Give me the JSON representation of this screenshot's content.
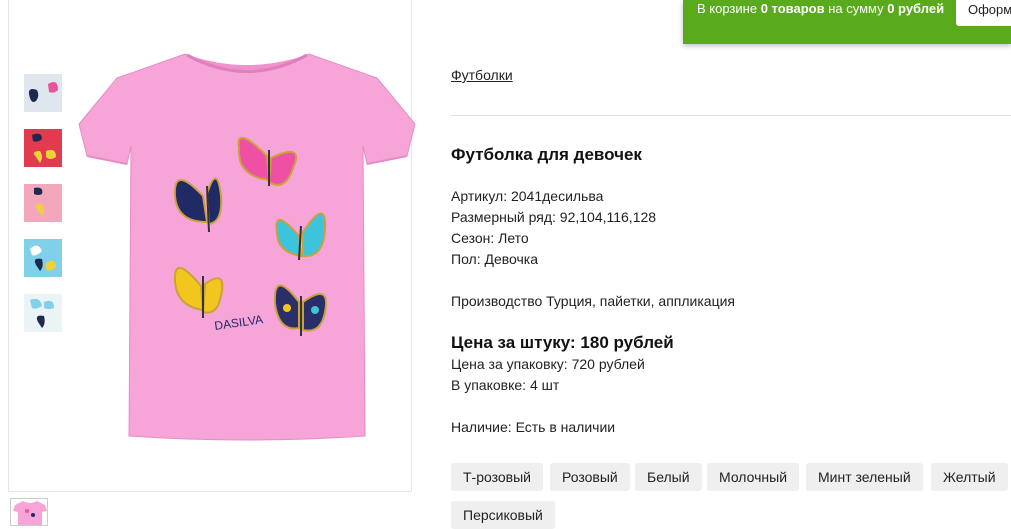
{
  "cart": {
    "prefix": "В корзине ",
    "count": "0 товаров",
    "middle": " на сумму ",
    "sum": "0 рублей",
    "button_label": "Оформить"
  },
  "breadcrumb": "Футболки",
  "product": {
    "title": "Футболка для девочек",
    "article": "Артикул: 2041десильва",
    "sizes": "Размерный ряд: 92,104,116,128",
    "season": "Сезон: Лето",
    "gender": "Пол: Девочка",
    "production": "Производство Турция, пайетки, аппликация",
    "price_unit": "Цена за штуку: 180 рублей",
    "price_pack": "Цена за упаковку: 720 рублей",
    "pack_qty": "В упаковке: 4 шт",
    "availability": "Наличие: Есть в наличии",
    "brand_print": "DASILVA"
  },
  "colors": [
    "Т-розовый",
    "Розовый",
    "Белый",
    "Молочный",
    "Минт зеленый",
    "Желтый",
    "Персиковый"
  ],
  "thumbnails": [
    {
      "name": "thumb-white",
      "bg": "#dfe6ee"
    },
    {
      "name": "thumb-red",
      "bg": "#e23a4e"
    },
    {
      "name": "thumb-pink",
      "bg": "#f2a7bd"
    },
    {
      "name": "thumb-blue",
      "bg": "#7fd0e8"
    },
    {
      "name": "thumb-light",
      "bg": "#eaf3f6"
    }
  ],
  "theme": {
    "cart_green": "#5aaa1d",
    "shirt_pink": "#f7a4d8",
    "chip_bg": "#efefef"
  }
}
